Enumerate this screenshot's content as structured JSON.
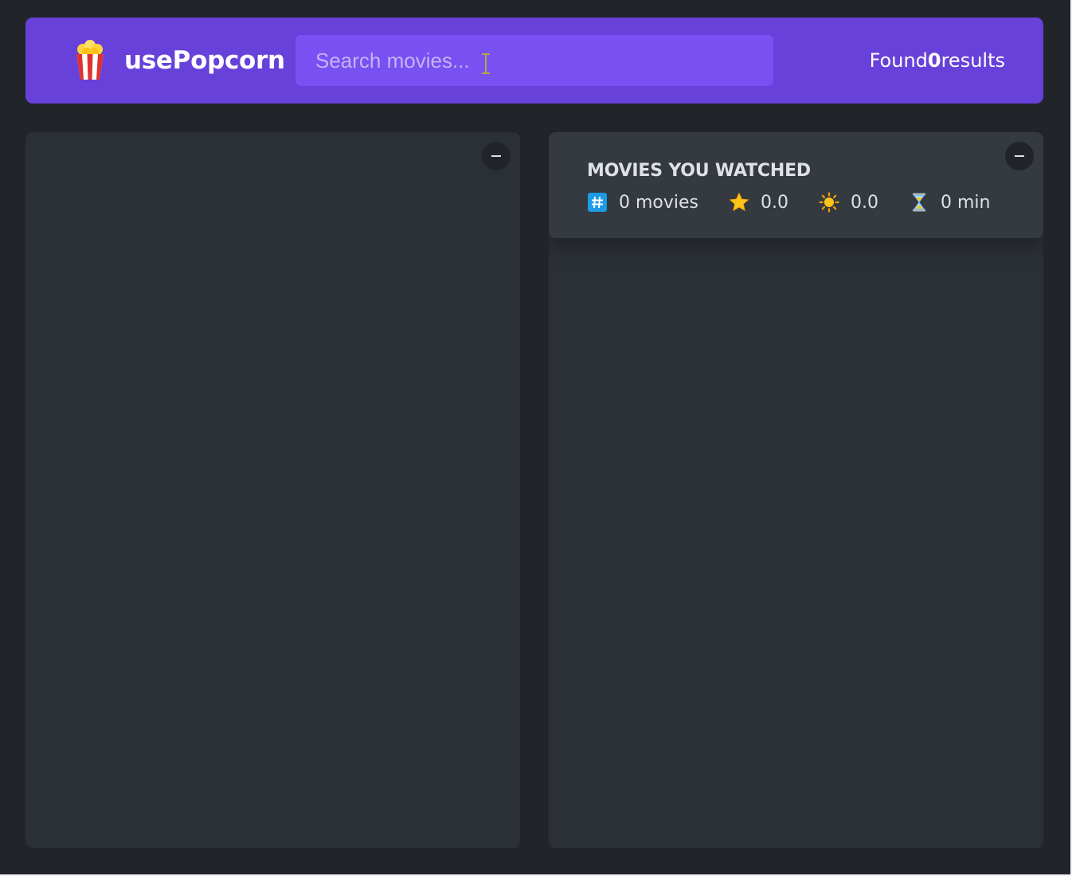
{
  "nav": {
    "logo_icon": "popcorn-icon",
    "logo_text": "usePopcorn",
    "search": {
      "placeholder": "Search movies...",
      "value": ""
    },
    "results": {
      "prefix": "Found",
      "count": "0",
      "suffix": "results"
    }
  },
  "left_box": {
    "toggle_label": "–"
  },
  "right_box": {
    "toggle_label": "–",
    "summary": {
      "title": "MOVIES YOU WATCHED",
      "stats": [
        {
          "icon": "hash-icon",
          "value": "0 movies"
        },
        {
          "icon": "star-icon",
          "value": "0.0"
        },
        {
          "icon": "sun-icon",
          "value": "0.0"
        },
        {
          "icon": "hourglass-icon",
          "value": "0 min"
        }
      ]
    }
  },
  "colors": {
    "background": "#212529",
    "nav": "#6741d9",
    "search": "#7950f2",
    "box": "#2b3035",
    "summary": "#343a40"
  }
}
